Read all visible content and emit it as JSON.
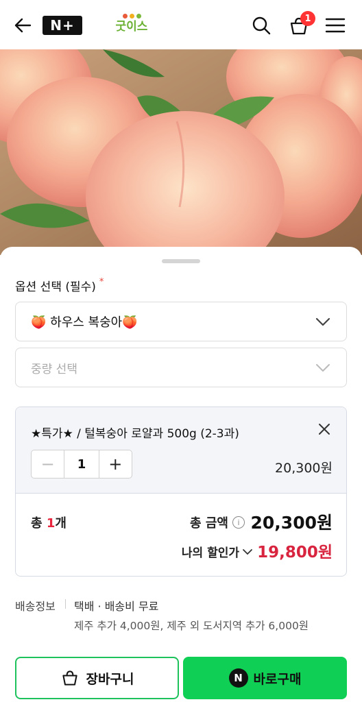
{
  "header": {
    "nplus_label": "N+",
    "brand_name": "굿이스",
    "brand_dot_colors": [
      "#e85a3a",
      "#f2b01e",
      "#7cb83a"
    ],
    "cart_count": "1",
    "icons": [
      "back-arrow-icon",
      "search-icon",
      "cart-icon",
      "hamburger-menu-icon"
    ]
  },
  "sheet": {
    "option_title": "옵션 선택 (필수)",
    "required_mark": "*",
    "select1_value": "🍑 하우스 복숭아🍑",
    "select2_placeholder": "중량 선택",
    "selected_item": {
      "name": "★특가★ / 털복숭아 로얄과 500g (2-3과)",
      "quantity": "1",
      "price": "20,300원"
    },
    "total": {
      "count_prefix": "총 ",
      "count_num": "1",
      "count_suffix": "개",
      "amount_label": "총 금액",
      "amount": "20,300원",
      "discount_label": "나의 할인가",
      "discount_price": "19,800원"
    },
    "shipping": {
      "label": "배송정보",
      "value": "택배 · 배송비 무료",
      "note": "제주 추가 4,000원, 제주 외 도서지역 추가 6,000원"
    },
    "buttons": {
      "cart_label": "장바구니",
      "buy_label": "바로구매",
      "npay_letter": "N"
    }
  },
  "colors": {
    "accent_green": "#0fcf54",
    "discount_red": "#d8243f",
    "badge_red": "#ff3333"
  }
}
